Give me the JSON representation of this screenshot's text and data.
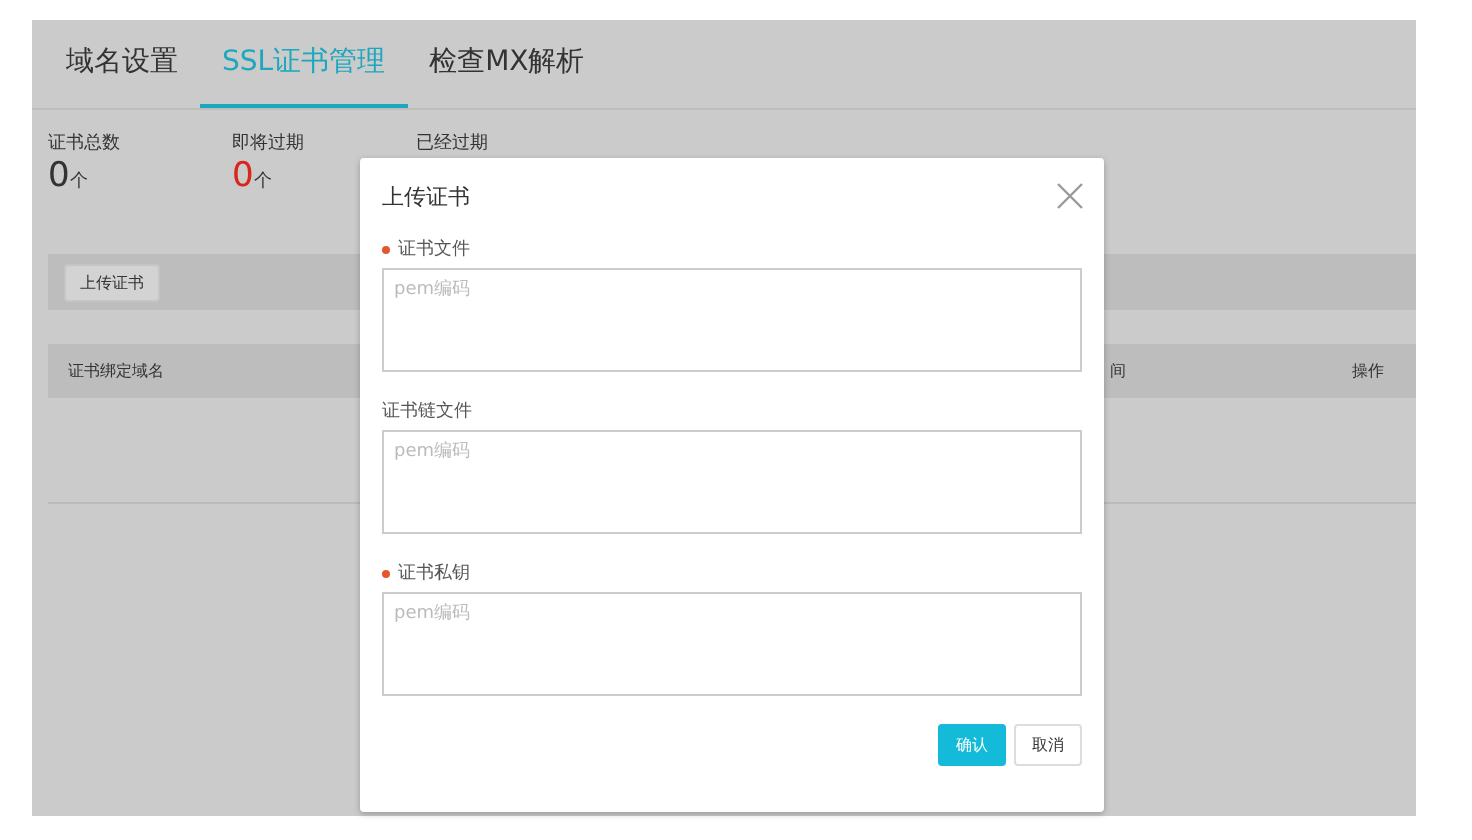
{
  "tabs": [
    {
      "label": "域名设置",
      "selected": false
    },
    {
      "label": "SSL证书管理",
      "selected": true
    },
    {
      "label": "检查MX解析",
      "selected": false
    }
  ],
  "stats": [
    {
      "label": "证书总数",
      "value": "0",
      "unit": "个",
      "color": "#333333"
    },
    {
      "label": "即将过期",
      "value": "0",
      "unit": "个",
      "color": "#d9261c"
    },
    {
      "label": "已经过期"
    }
  ],
  "toolbar": {
    "button": "上传证书"
  },
  "table": {
    "columns": [
      {
        "label": "证书绑定域名"
      },
      {
        "label": "间"
      },
      {
        "label": "操作"
      }
    ]
  },
  "dialog": {
    "title": "上传证书",
    "fields": [
      {
        "label": "证书文件",
        "required": true,
        "placeholder": "pem编码"
      },
      {
        "label": "证书链文件",
        "required": false,
        "placeholder": "pem编码"
      },
      {
        "label": "证书私钥",
        "required": true,
        "placeholder": "pem编码"
      }
    ],
    "buttons": [
      {
        "label": "确认",
        "kind": "primary"
      },
      {
        "label": "取消",
        "kind": "default"
      }
    ]
  }
}
